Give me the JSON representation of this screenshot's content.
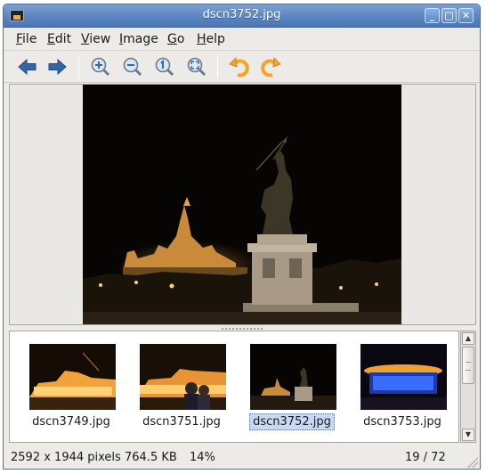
{
  "window": {
    "title": "dscn3752.jpg",
    "minimize_label": "_",
    "maximize_label": "□",
    "close_label": "✕"
  },
  "menubar": {
    "items": [
      {
        "mnemonic": "F",
        "rest": "ile"
      },
      {
        "mnemonic": "E",
        "rest": "dit"
      },
      {
        "mnemonic": "V",
        "rest": "iew"
      },
      {
        "mnemonic": "I",
        "rest": "mage"
      },
      {
        "mnemonic": "G",
        "rest": "o"
      },
      {
        "mnemonic": "H",
        "rest": "elp"
      }
    ]
  },
  "toolbar": {
    "buttons": [
      "back-arrow-icon",
      "forward-arrow-icon",
      "zoom-in-icon",
      "zoom-out-icon",
      "zoom-normal-icon",
      "zoom-fit-icon",
      "rotate-left-icon",
      "rotate-right-icon"
    ],
    "arrow_color": "#3465a4",
    "rotate_color": "#f5a524"
  },
  "thumbnails": [
    {
      "filename": "dscn3749.jpg",
      "selected": false
    },
    {
      "filename": "dscn3751.jpg",
      "selected": false
    },
    {
      "filename": "dscn3752.jpg",
      "selected": true
    },
    {
      "filename": "dscn3753.jpg",
      "selected": false
    }
  ],
  "status": {
    "dimensions": "2592 x 1944 pixels",
    "filesize": "764.5 KB",
    "zoom": "14%",
    "position": "19 / 72"
  },
  "scrollbar": {
    "up": "▲",
    "down": "▼"
  }
}
